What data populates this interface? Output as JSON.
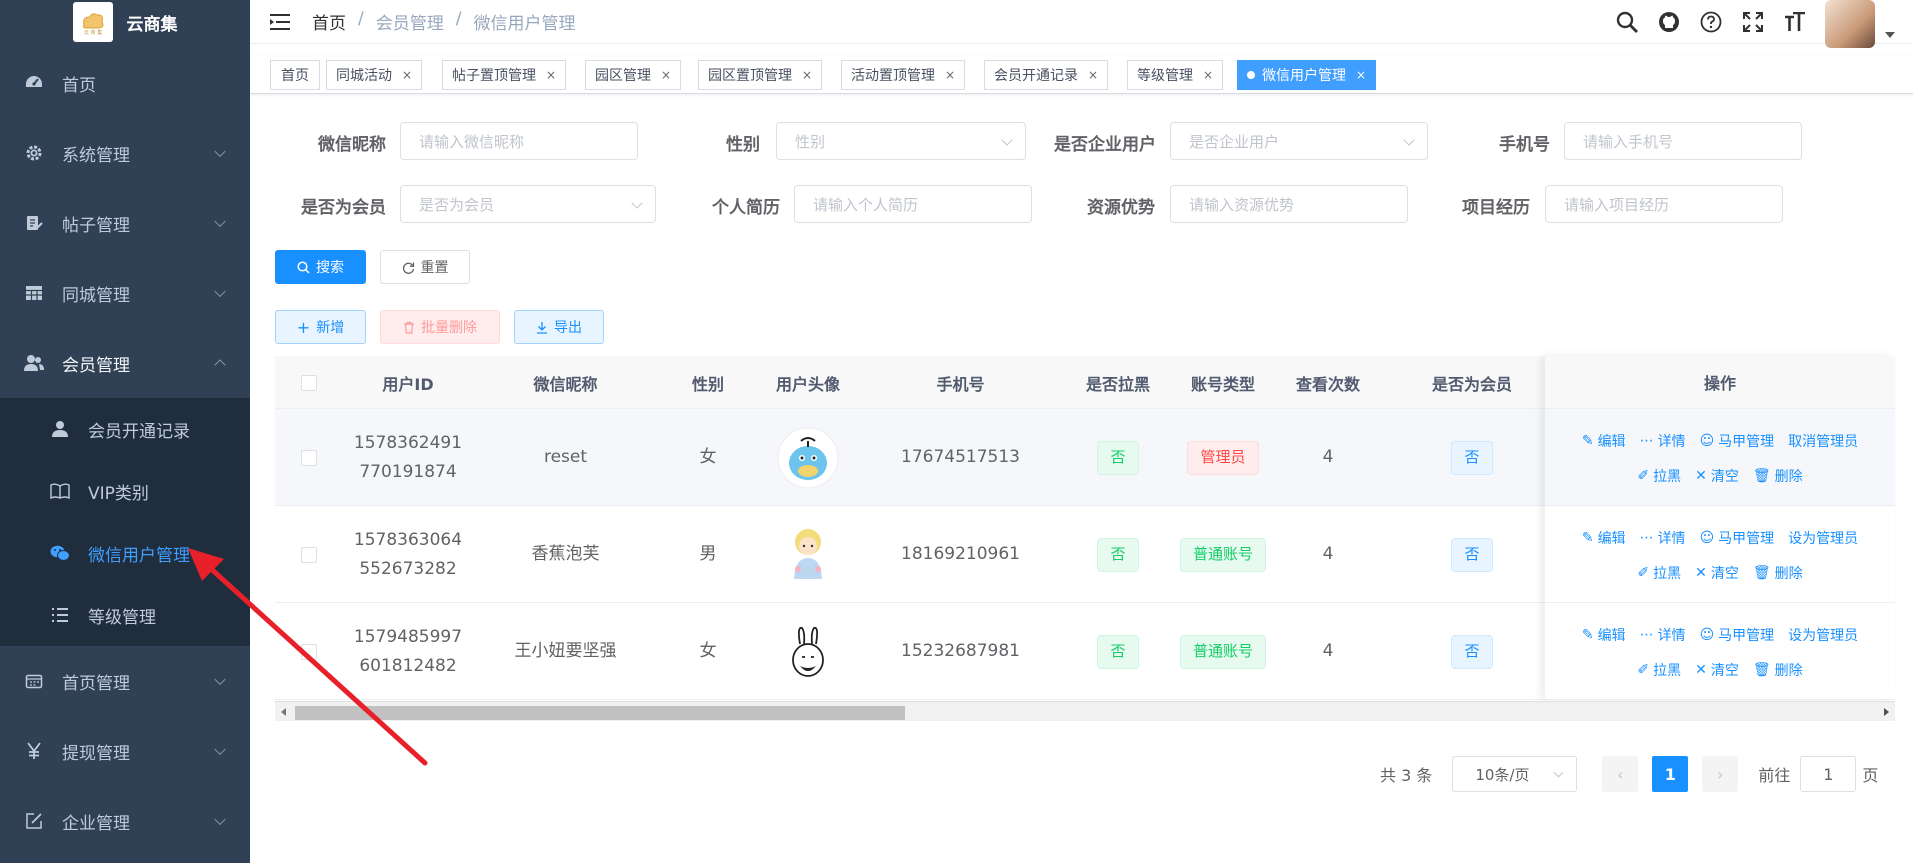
{
  "sidebar": {
    "logo_title": "云商集",
    "menu": [
      {
        "label": "首页",
        "icon": "dashboard-icon"
      },
      {
        "label": "系统管理",
        "icon": "gear-icon"
      },
      {
        "label": "帖子管理",
        "icon": "edit-doc-icon"
      },
      {
        "label": "同城管理",
        "icon": "table-icon"
      },
      {
        "label": "会员管理",
        "icon": "peoples-icon"
      }
    ],
    "submenu": [
      {
        "label": "会员开通记录",
        "icon": "user-icon"
      },
      {
        "label": "VIP类别",
        "icon": "book-icon"
      },
      {
        "label": "微信用户管理",
        "icon": "wechat-icon"
      },
      {
        "label": "等级管理",
        "icon": "list-icon"
      }
    ],
    "menu_bottom": [
      {
        "label": "首页管理",
        "icon": "calendar-icon"
      },
      {
        "label": "提现管理",
        "icon": "yen-icon"
      },
      {
        "label": "企业管理",
        "icon": "form-icon"
      }
    ]
  },
  "breadcrumb": [
    "首页",
    "会员管理",
    "微信用户管理"
  ],
  "tags": [
    {
      "label": "首页",
      "closable": false
    },
    {
      "label": "同城活动",
      "closable": true
    },
    {
      "label": "帖子置顶管理",
      "closable": true
    },
    {
      "label": "园区管理",
      "closable": true
    },
    {
      "label": "园区置顶管理",
      "closable": true
    },
    {
      "label": "活动置顶管理",
      "closable": true
    },
    {
      "label": "会员开通记录",
      "closable": true
    },
    {
      "label": "等级管理",
      "closable": true
    },
    {
      "label": "微信用户管理",
      "closable": true,
      "active": true
    }
  ],
  "tag_close_glyph": "×",
  "breadcrumb_sep": "/",
  "filters": {
    "nickname": {
      "label": "微信昵称",
      "placeholder": "请输入微信昵称"
    },
    "gender": {
      "label": "性别",
      "placeholder": "性别"
    },
    "is_enterprise": {
      "label": "是否企业用户",
      "placeholder": "是否企业用户"
    },
    "phone": {
      "label": "手机号",
      "placeholder": "请输入手机号"
    },
    "is_member": {
      "label": "是否为会员",
      "placeholder": "是否为会员"
    },
    "resume": {
      "label": "个人简历",
      "placeholder": "请输入个人简历"
    },
    "advantage": {
      "label": "资源优势",
      "placeholder": "请输入资源优势"
    },
    "experience": {
      "label": "项目经历",
      "placeholder": "请输入项目经历"
    }
  },
  "buttons": {
    "search": "搜索",
    "reset": "重置",
    "add": "新增",
    "batch_delete": "批量删除",
    "export": "导出"
  },
  "table": {
    "columns": [
      "用户ID",
      "微信昵称",
      "性别",
      "用户头像",
      "手机号",
      "是否拉黑",
      "账号类型",
      "查看次数",
      "是否为会员",
      "操作"
    ],
    "rows": [
      {
        "id_line1": "1578362491",
        "id_line2": "770191874",
        "nickname": "reset",
        "gender": "女",
        "phone": "17674517513",
        "blacklisted": "否",
        "account_type": "管理员",
        "view_count": "4",
        "is_member": "否",
        "admin_action": "取消管理员"
      },
      {
        "id_line1": "1578363064",
        "id_line2": "552673282",
        "nickname": "香蕉泡芙",
        "gender": "男",
        "phone": "18169210961",
        "blacklisted": "否",
        "account_type": "普通账号",
        "view_count": "4",
        "is_member": "否",
        "admin_action": "设为管理员"
      },
      {
        "id_line1": "1579485997",
        "id_line2": "601812482",
        "nickname": "王小妞要坚强",
        "gender": "女",
        "phone": "15232687981",
        "blacklisted": "否",
        "account_type": "普通账号",
        "view_count": "4",
        "is_member": "否",
        "admin_action": "设为管理员"
      }
    ],
    "ops": {
      "edit": "编辑",
      "detail": "详情",
      "vest": "马甲管理",
      "block": "拉黑",
      "clear": "清空",
      "delete": "删除"
    }
  },
  "pagination": {
    "total": "共 3 条",
    "page_size": "10条/页",
    "current": "1",
    "goto_prefix": "前往",
    "goto_value": "1",
    "goto_suffix": "页"
  },
  "colors": {
    "sidebar_bg": "#304156",
    "primary": "#1890ff",
    "annotation_arrow": "#e8202a"
  }
}
